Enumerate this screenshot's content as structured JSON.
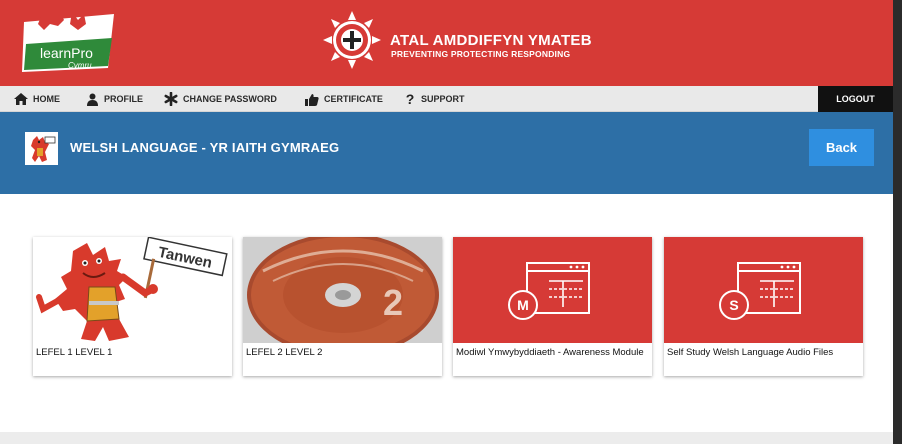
{
  "header": {
    "logo_text": "learnPro",
    "logo_sub": "Cymru",
    "brand_title": "ATAL AMDDIFFYN YMATEB",
    "brand_subtitle": "PREVENTING PROTECTING RESPONDING",
    "colors": {
      "header_bg": "#d63a36",
      "title_band_bg": "#2d6fa6",
      "back_button_bg": "#2f8fe0"
    }
  },
  "nav": {
    "items": [
      {
        "label": "HOME",
        "icon": "home-icon"
      },
      {
        "label": "PROFILE",
        "icon": "user-icon"
      },
      {
        "label": "CHANGE PASSWORD",
        "icon": "asterisk-icon"
      },
      {
        "label": "CERTIFICATE",
        "icon": "certificate-icon"
      },
      {
        "label": "SUPPORT",
        "icon": "question-icon"
      }
    ],
    "logout_label": "LOGOUT"
  },
  "page": {
    "title": "WELSH LANGUAGE - YR IAITH GYMRAEG",
    "back_label": "Back"
  },
  "cards": [
    {
      "label": "LEFEL 1 LEVEL 1",
      "sign_text": "Tanwen"
    },
    {
      "label": "LEFEL 2 LEVEL 2",
      "disc_number": "2"
    },
    {
      "label": "Modiwl Ymwybyddiaeth - Awareness Module",
      "badge": "M"
    },
    {
      "label": "Self Study Welsh Language Audio Files",
      "badge": "S"
    }
  ]
}
